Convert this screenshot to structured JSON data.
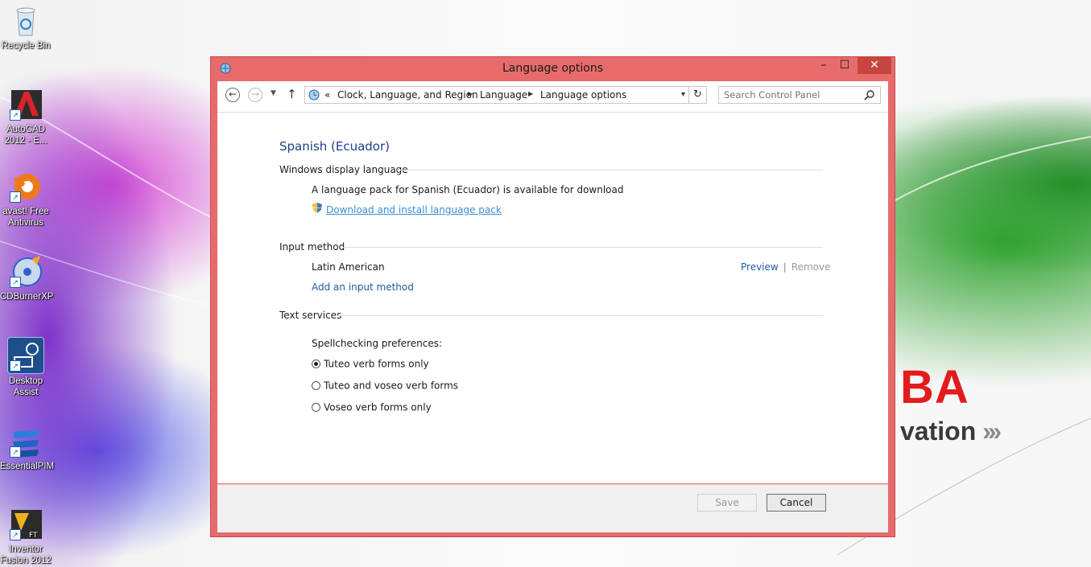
{
  "desktop": {
    "icons": [
      {
        "label": "Recycle Bin"
      },
      {
        "label": "AutoCAD 2012 - E..."
      },
      {
        "label": "avast! Free Antivirus"
      },
      {
        "label": "CDBurnerXP"
      },
      {
        "label": "Desktop Assist"
      },
      {
        "label": "EssentialPIM"
      },
      {
        "label": "Inventor Fusion 2012"
      }
    ],
    "brand": {
      "text": "BA",
      "sub": "vation",
      "chevrons": "›››"
    }
  },
  "window": {
    "title": "Language options",
    "controls": {
      "minimize": "–",
      "maximize": "☐",
      "close": "✕"
    },
    "address": {
      "overflow": "«",
      "crumbs": [
        "Clock, Language, and Region",
        "Language",
        "Language options"
      ]
    },
    "search": {
      "placeholder": "Search Control Panel"
    },
    "page_title": "Spanish (Ecuador)",
    "display_language": {
      "heading": "Windows display language",
      "message": "A language pack for Spanish (Ecuador) is available for download",
      "download_link": "Download and install language pack"
    },
    "input_method": {
      "heading": "Input method",
      "method_name": "Latin American",
      "preview": "Preview",
      "separator": "|",
      "remove": "Remove",
      "add_link": "Add an input method"
    },
    "text_services": {
      "heading": "Text services",
      "spellcheck_label": "Spellchecking preferences:",
      "options": [
        {
          "label": "Tuteo verb forms only",
          "checked": true
        },
        {
          "label": "Tuteo and voseo verb forms",
          "checked": false
        },
        {
          "label": "Voseo verb forms only",
          "checked": false
        }
      ]
    },
    "footer": {
      "save": "Save",
      "cancel": "Cancel"
    }
  },
  "colors": {
    "window_frame": "#e86b6b",
    "link": "#1e5b9e",
    "title_blue": "#1e3f8a",
    "close_button": "#c7453f"
  }
}
